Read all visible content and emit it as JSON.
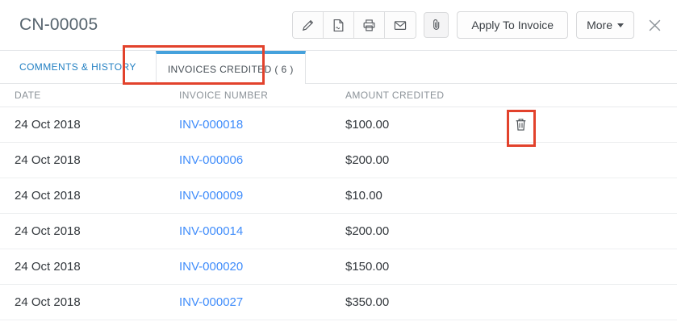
{
  "header": {
    "title": "CN-00005",
    "toolbar": {
      "edit_icon": "pencil",
      "export_pdf_icon": "pdf-file",
      "print_icon": "printer",
      "email_icon": "envelope",
      "attachment_icon": "paperclip",
      "apply_label": "Apply To Invoice",
      "more_label": "More",
      "more_caret_icon": "caret-down",
      "close_icon": "x-cross"
    }
  },
  "tabs": [
    {
      "label": "COMMENTS & HISTORY",
      "active": false
    },
    {
      "label": "INVOICES CREDITED ( 6 )",
      "active": true
    }
  ],
  "table": {
    "columns": [
      "DATE",
      "INVOICE NUMBER",
      "AMOUNT CREDITED"
    ],
    "rows": [
      {
        "date": "24 Oct 2018",
        "invoice_number": "INV-000018",
        "amount_credited": "$100.00",
        "delete_icon_visible": true
      },
      {
        "date": "24 Oct 2018",
        "invoice_number": "INV-000006",
        "amount_credited": "$200.00",
        "delete_icon_visible": false
      },
      {
        "date": "24 Oct 2018",
        "invoice_number": "INV-000009",
        "amount_credited": "$10.00",
        "delete_icon_visible": false
      },
      {
        "date": "24 Oct 2018",
        "invoice_number": "INV-000014",
        "amount_credited": "$200.00",
        "delete_icon_visible": false
      },
      {
        "date": "24 Oct 2018",
        "invoice_number": "INV-000020",
        "amount_credited": "$150.00",
        "delete_icon_visible": false
      },
      {
        "date": "24 Oct 2018",
        "invoice_number": "INV-000027",
        "amount_credited": "$350.00",
        "delete_icon_visible": false
      }
    ]
  },
  "annotations": {
    "highlighted_tab": "INVOICES CREDITED ( 6 )",
    "highlighted_icon": "trash-icon",
    "box_color": "#e2422c"
  },
  "colors": {
    "accent_blue": "#408dfb",
    "tab_text_blue": "#2380c3",
    "active_tab_bar": "#45a1dc",
    "annotation_red": "#e2422c",
    "title": "#56646e",
    "text_dark": "#33383d",
    "text_muted": "#8b9298",
    "border": "#e4e6e9",
    "row_border": "#eef0f1"
  }
}
